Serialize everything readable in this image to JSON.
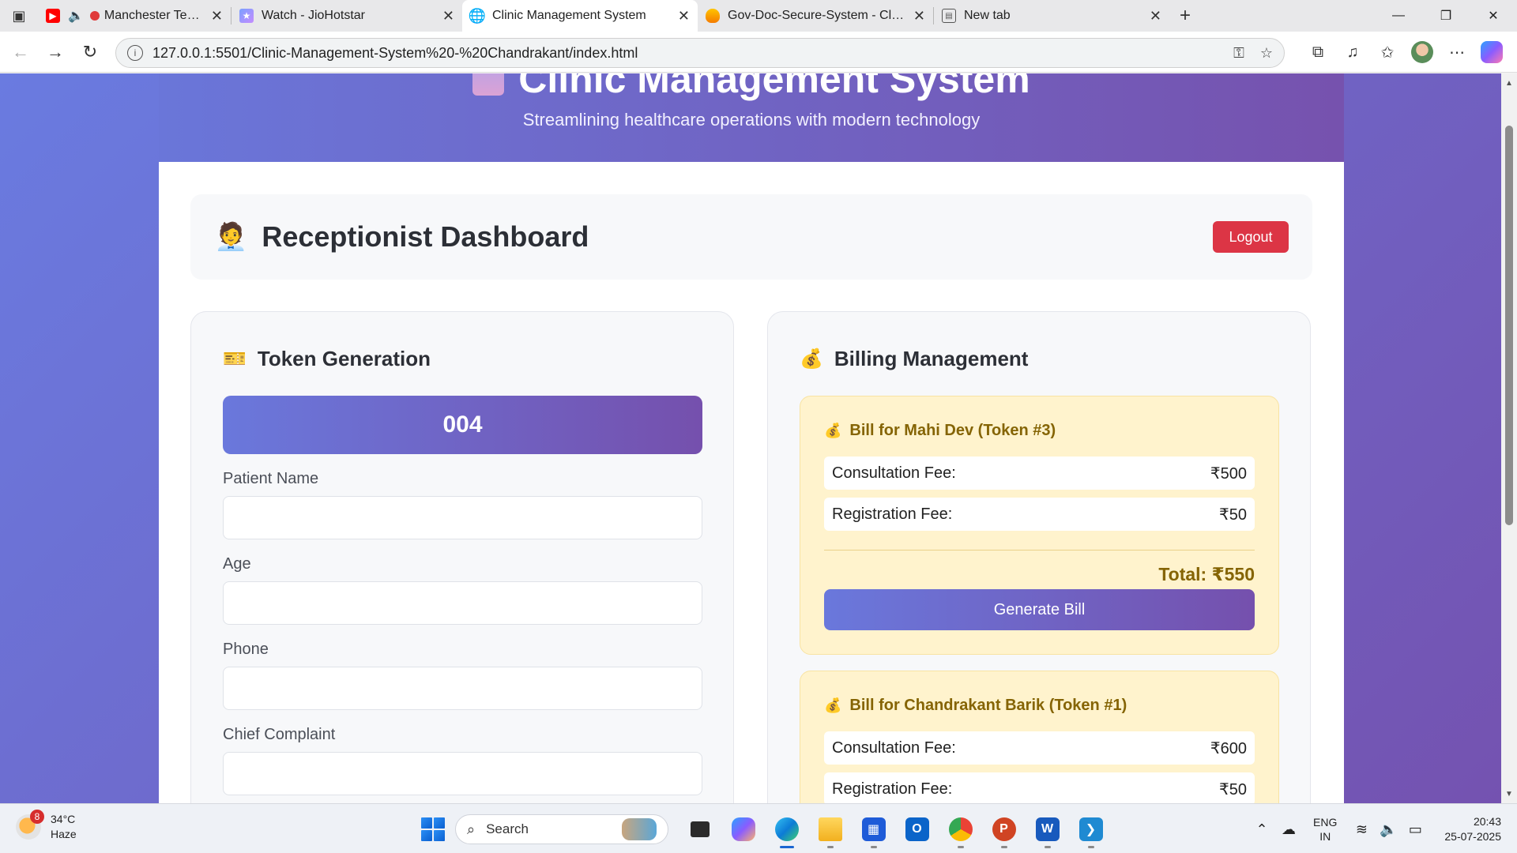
{
  "browser": {
    "tabs": [
      {
        "title": "Manchester Test: India Ne",
        "icon": "youtube-icon",
        "active": false
      },
      {
        "title": "Watch - JioHotstar",
        "icon": "jiohotstar-icon",
        "active": false
      },
      {
        "title": "Clinic Management System",
        "icon": "globe-icon",
        "active": true
      },
      {
        "title": "Gov-Doc-Secure-System - Cloud",
        "icon": "firebase-icon",
        "active": false
      },
      {
        "title": "New tab",
        "icon": "newtab-icon",
        "active": false
      }
    ],
    "url": "127.0.0.1:5501/Clinic-Management-System%20-%20Chandrakant/index.html"
  },
  "page": {
    "hero": {
      "title": "Clinic Management System",
      "subtitle": "Streamlining healthcare operations with modern technology"
    },
    "dashboard": {
      "icon": "🧑‍💼",
      "title": "Receptionist Dashboard",
      "logout_label": "Logout"
    },
    "token_generation": {
      "icon": "🎫",
      "title": "Token Generation",
      "token_number": "004",
      "fields": [
        {
          "label": "Patient Name",
          "value": ""
        },
        {
          "label": "Age",
          "value": ""
        },
        {
          "label": "Phone",
          "value": ""
        },
        {
          "label": "Chief Complaint",
          "value": ""
        }
      ]
    },
    "billing": {
      "icon": "💰",
      "title": "Billing Management",
      "bills": [
        {
          "title": "Bill for Mahi Dev (Token #3)",
          "consultation_label": "Consultation Fee:",
          "consultation_fee": "₹500",
          "registration_label": "Registration Fee:",
          "registration_fee": "₹50",
          "total": "Total: ₹550",
          "button_label": "Generate Bill"
        },
        {
          "title": "Bill for Chandrakant Barik (Token #1)",
          "consultation_label": "Consultation Fee:",
          "consultation_fee": "₹600",
          "registration_label": "Registration Fee:",
          "registration_fee": "₹50"
        }
      ]
    }
  },
  "taskbar": {
    "weather": {
      "badge": "8",
      "temp": "34°C",
      "condition": "Haze"
    },
    "search_label": "Search",
    "lang_line1": "ENG",
    "lang_line2": "IN",
    "time": "20:43",
    "date": "25-07-2025"
  },
  "colors": {
    "accent_gradient_start": "#6a78dc",
    "accent_gradient_end": "#7550ad",
    "logout_red": "#dc3545",
    "bill_bg": "#fff3cd",
    "bill_text": "#856404"
  }
}
